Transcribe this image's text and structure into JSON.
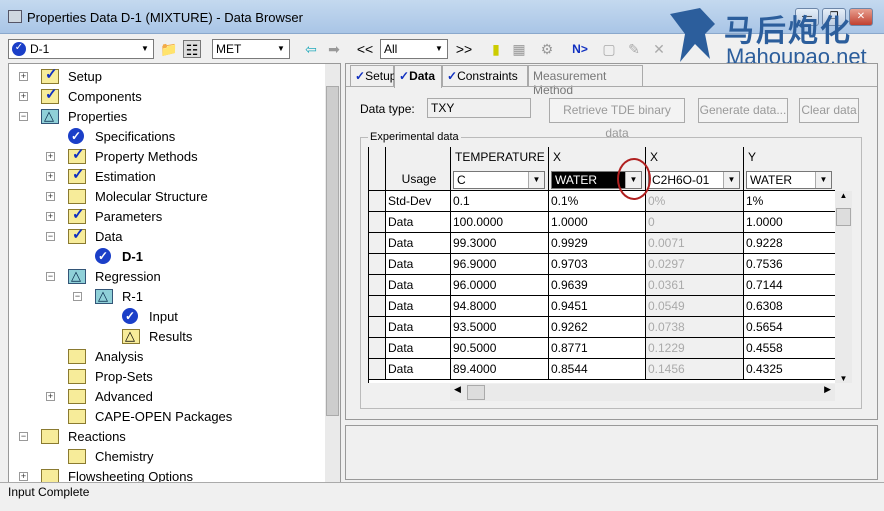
{
  "window": {
    "title": "Properties Data D-1 (MIXTURE) - Data Browser",
    "min": "—",
    "max": "❐",
    "close": "✕"
  },
  "watermark": {
    "cn": "马后炮化工",
    "en": "Mahoupao.net"
  },
  "toolbar": {
    "object": "D-1",
    "units": "MET",
    "filter": "All",
    "prev": "<<",
    "next": ">>",
    "n_label": "N>"
  },
  "tree": [
    {
      "label": "Setup",
      "level": 0,
      "icon": "check",
      "exp": "+"
    },
    {
      "label": "Components",
      "level": 0,
      "icon": "check",
      "exp": "+"
    },
    {
      "label": "Properties",
      "level": 0,
      "icon": "tri",
      "exp": "-"
    },
    {
      "label": "Specifications",
      "level": 1,
      "icon": "blue",
      "exp": ""
    },
    {
      "label": "Property Methods",
      "level": 1,
      "icon": "check",
      "exp": "+"
    },
    {
      "label": "Estimation",
      "level": 1,
      "icon": "check",
      "exp": "+"
    },
    {
      "label": "Molecular Structure",
      "level": 1,
      "icon": "folder",
      "exp": "+"
    },
    {
      "label": "Parameters",
      "level": 1,
      "icon": "check",
      "exp": "+"
    },
    {
      "label": "Data",
      "level": 1,
      "icon": "check",
      "exp": "-"
    },
    {
      "label": "D-1",
      "level": 2,
      "icon": "blue",
      "exp": "",
      "bold": true
    },
    {
      "label": "Regression",
      "level": 1,
      "icon": "tri",
      "exp": "-"
    },
    {
      "label": "R-1",
      "level": 2,
      "icon": "tri",
      "exp": "-"
    },
    {
      "label": "Input",
      "level": 3,
      "icon": "blue",
      "exp": ""
    },
    {
      "label": "Results",
      "level": 3,
      "icon": "ytri",
      "exp": ""
    },
    {
      "label": "Analysis",
      "level": 1,
      "icon": "folder",
      "exp": ""
    },
    {
      "label": "Prop-Sets",
      "level": 1,
      "icon": "folder",
      "exp": ""
    },
    {
      "label": "Advanced",
      "level": 1,
      "icon": "folder",
      "exp": "+"
    },
    {
      "label": "CAPE-OPEN Packages",
      "level": 1,
      "icon": "folder",
      "exp": ""
    },
    {
      "label": "Reactions",
      "level": 0,
      "icon": "folder",
      "exp": "-"
    },
    {
      "label": "Chemistry",
      "level": 1,
      "icon": "folder",
      "exp": ""
    },
    {
      "label": "Flowsheeting Options",
      "level": 0,
      "icon": "folder",
      "exp": "+"
    }
  ],
  "tabs": [
    {
      "label": "Setup",
      "check": true
    },
    {
      "label": "Data",
      "check": true,
      "active": true
    },
    {
      "label": "Constraints",
      "check": true
    },
    {
      "label": "Measurement Method",
      "check": false
    }
  ],
  "form": {
    "data_type_label": "Data type:",
    "data_type": "TXY",
    "retrieve": "Retrieve TDE binary data",
    "generate": "Generate data...",
    "clear": "Clear data",
    "group": "Experimental data"
  },
  "grid": {
    "headers": [
      "TEMPERATURE",
      "X",
      "X",
      "Y"
    ],
    "usage_label": "Usage",
    "units": [
      "C",
      "WATER",
      "C2H6O-01",
      "WATER"
    ],
    "rows": [
      [
        "Std-Dev",
        "0.1",
        "0.1%",
        "0%",
        "1%"
      ],
      [
        "Data",
        "100.0000",
        "1.0000",
        "0",
        "1.0000"
      ],
      [
        "Data",
        "99.3000",
        "0.9929",
        "0.0071",
        "0.9228"
      ],
      [
        "Data",
        "96.9000",
        "0.9703",
        "0.0297",
        "0.7536"
      ],
      [
        "Data",
        "96.0000",
        "0.9639",
        "0.0361",
        "0.7144"
      ],
      [
        "Data",
        "94.8000",
        "0.9451",
        "0.0549",
        "0.6308"
      ],
      [
        "Data",
        "93.5000",
        "0.9262",
        "0.0738",
        "0.5654"
      ],
      [
        "Data",
        "90.5000",
        "0.8771",
        "0.1229",
        "0.4558"
      ],
      [
        "Data",
        "89.4000",
        "0.8544",
        "0.1456",
        "0.4325"
      ]
    ]
  },
  "status": "Input Complete"
}
